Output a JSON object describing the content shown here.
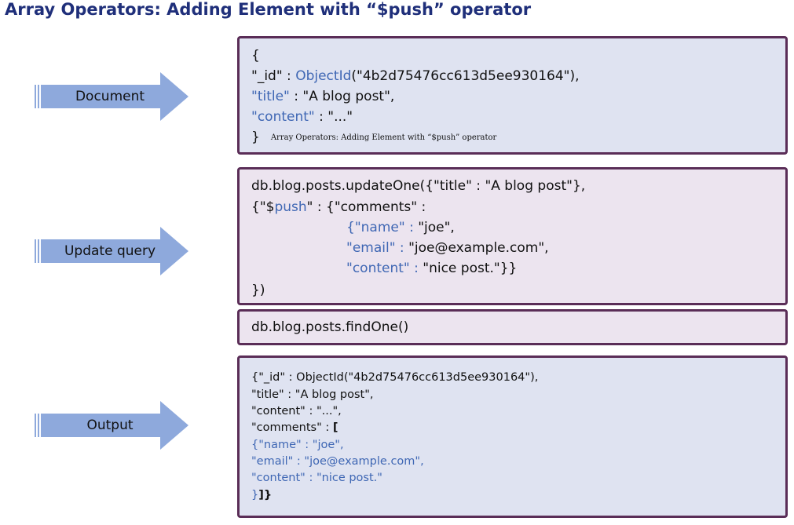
{
  "title": "Array Operators: Adding Element with “$push” operator",
  "arrows": [
    {
      "label": "Document"
    },
    {
      "label": "Update query"
    },
    {
      "label": "Output"
    }
  ],
  "document_box": {
    "l1": "{",
    "l2_key": "\"_id\" : ",
    "l2_fn": "ObjectId",
    "l2_val": "(\"4b2d75476cc613d5ee930164\"),",
    "l3_key": "\"title\"",
    "l3_val": " : \"A blog post\",",
    "l4_key": "\"content\"",
    "l4_val": " : \"...\"",
    "l5": "}",
    "note": "Array Operators: Adding Element with “$push” operator"
  },
  "update_box": {
    "l1": "db.blog.posts.updateOne({\"title\" : \"A blog post\"},",
    "l2_pre": "{\"$",
    "l2_op": "push",
    "l2_post": "\" : {\"comments\" :",
    "l3_key": "{\"name\" : ",
    "l3_val": "\"joe\",",
    "l4_key": "\"email\" : ",
    "l4_val": "\"joe@example.com\",",
    "l5_key": "\"content\" : ",
    "l5_val": "\"nice post.\"}}",
    "l6": "})"
  },
  "find_box": {
    "l1": "db.blog.posts.findOne()"
  },
  "output_box": {
    "l1": "{\"_id\" : ObjectId(\"4b2d75476cc613d5ee930164\"),",
    "l2": "\"title\" : \"A blog post\",",
    "l3": "\"content\" : \"...\",",
    "l4_pre": "\"comments\" : ",
    "l4_bracket": "[",
    "l5": "{\"name\" : \"joe\",",
    "l6": "\"email\" : \"joe@example.com\",",
    "l7": "\"content\" : \"nice post.\"",
    "l8_pre": "}",
    "l8_post": "]}"
  },
  "colors": {
    "key": "#3f67b4",
    "arrow": "#8ea9dc",
    "border": "#5a2d57",
    "title": "#1f2f7a"
  }
}
